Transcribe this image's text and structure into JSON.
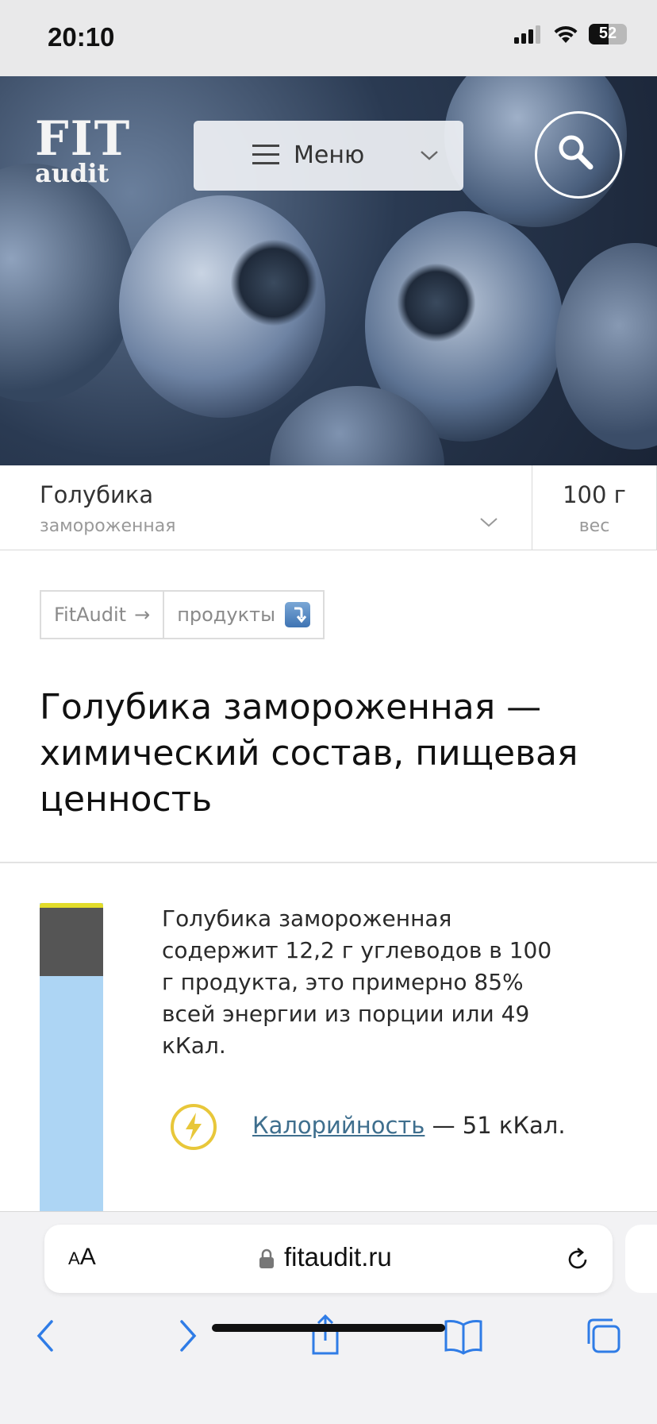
{
  "status_bar": {
    "time": "20:10",
    "battery_level": "52",
    "battery_fraction": 0.52,
    "icons": [
      "cellular-signal-icon",
      "wifi-icon",
      "battery-icon"
    ]
  },
  "header": {
    "logo_top": "FIT",
    "logo_bottom": "audit",
    "menu_label": "Меню",
    "menu_icon": "hamburger-icon",
    "search_icon": "search-icon"
  },
  "product_selector": {
    "name": "Голубика",
    "variant": "замороженная",
    "weight_value": "100 г",
    "weight_label": "вес"
  },
  "breadcrumb": {
    "items": [
      "FitAudit",
      "продукты"
    ],
    "arrow": "→",
    "dropdown_icon": "arrow-down-box-icon"
  },
  "page": {
    "title": "Голубика замороженная — химический состав, пищевая ценность",
    "summary": "Голубика замороженная содержит 12,2 г углеводов в 100 г продукта, это примерно 85% всей энергии из порции или 49 кКал.",
    "calorie_link": "Калорийность",
    "calorie_value": " — 51 кКал.",
    "calorie_icon": "lightning-icon",
    "colors": {
      "carb_bar": "#add5f4",
      "other_bar": "#555555",
      "fat_bar": "#e2dc2a",
      "link": "#3f6f8e",
      "calorie_icon": "#e8c73a"
    }
  },
  "browser": {
    "text_size_label": "AA",
    "url": "fitaudit.ru",
    "lock_icon": "lock-icon",
    "reload_icon": "reload-icon",
    "toolbar_icons": [
      "back-icon",
      "forward-icon",
      "share-icon",
      "bookmarks-icon",
      "tabs-icon"
    ]
  }
}
